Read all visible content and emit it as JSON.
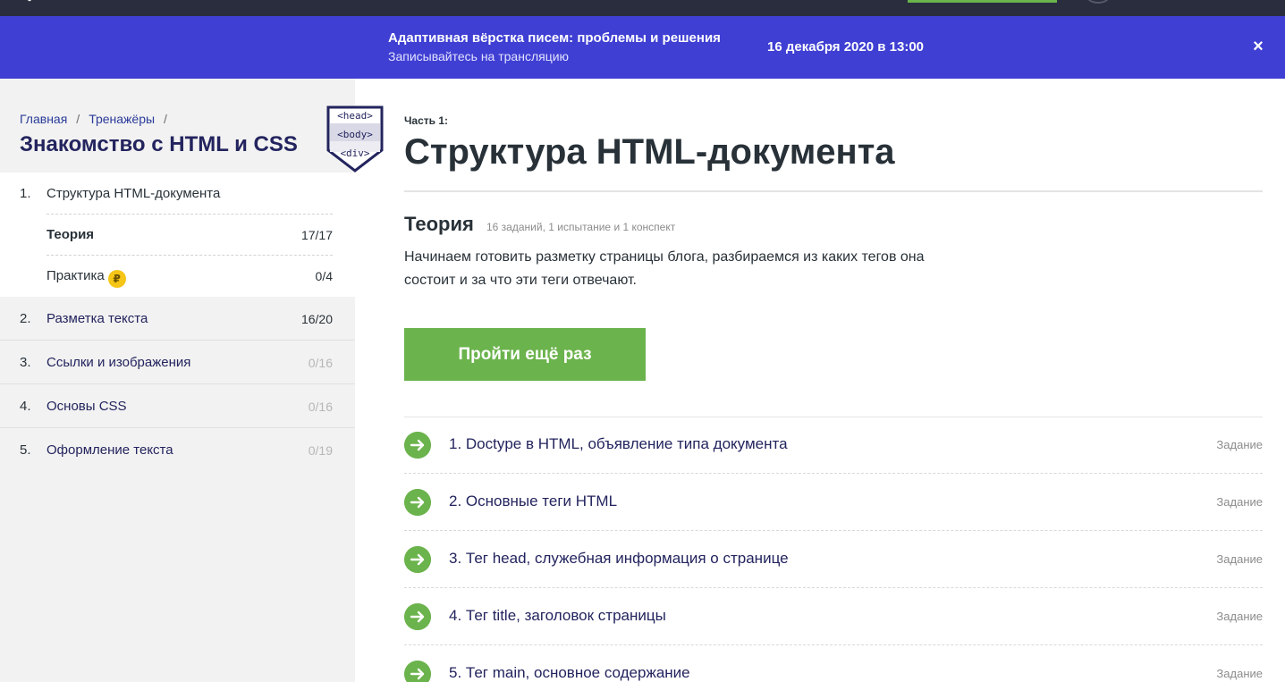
{
  "banner": {
    "title": "Адаптивная вёрстка писем: проблемы и решения",
    "subtitle": "Записывайтесь на трансляцию",
    "date": "16 декабря 2020 в 13:00",
    "close": "×"
  },
  "breadcrumb": {
    "home": "Главная",
    "trainers": "Тренажёры",
    "sep": "/"
  },
  "course": {
    "title": "Знакомство с HTML и CSS",
    "badge": [
      "<head>",
      "<body>",
      "<div>"
    ]
  },
  "sections": [
    {
      "num": "1.",
      "label": "Структура HTML-документа",
      "count": ""
    },
    {
      "num": "2.",
      "label": "Разметка текста",
      "count": "16/20"
    },
    {
      "num": "3.",
      "label": "Ссылки и изображения",
      "count": "0/16"
    },
    {
      "num": "4.",
      "label": "Основы CSS",
      "count": "0/16"
    },
    {
      "num": "5.",
      "label": "Оформление текста",
      "count": "0/19"
    }
  ],
  "subsections": [
    {
      "label": "Теория",
      "count": "17/17"
    },
    {
      "label": "Практика",
      "count": "0/4",
      "coin": "₽"
    }
  ],
  "main": {
    "part": "Часть 1:",
    "title": "Структура HTML-документа",
    "theory_title": "Теория",
    "theory_meta": "16 заданий, 1 испытание и 1 конспект",
    "description": "Начинаем готовить разметку страницы блога, разбираемся из каких тегов она состоит и за что эти теги отвечают.",
    "button": "Пройти ещё раз"
  },
  "tasks": [
    {
      "title": "1. Doctype в HTML, объявление типа документа",
      "kind": "Задание"
    },
    {
      "title": "2. Основные теги HTML",
      "kind": "Задание"
    },
    {
      "title": "3. Тег head, служебная информация о странице",
      "kind": "Задание"
    },
    {
      "title": "4. Тег title, заголовок страницы",
      "kind": "Задание"
    },
    {
      "title": "5. Тег main, основное содержание",
      "kind": "Задание"
    }
  ],
  "colors": {
    "banner": "#3f3fd3",
    "accent_green": "#6bb34c",
    "sidebar_bg": "#f2f2f2",
    "title_navy": "#23245e",
    "coin": "#f5c517"
  },
  "icons": {
    "banner_close": "close-icon",
    "task_status": "arrow-right-circle-icon",
    "logo": "logo-icon",
    "badge": "course-badge-icon"
  }
}
